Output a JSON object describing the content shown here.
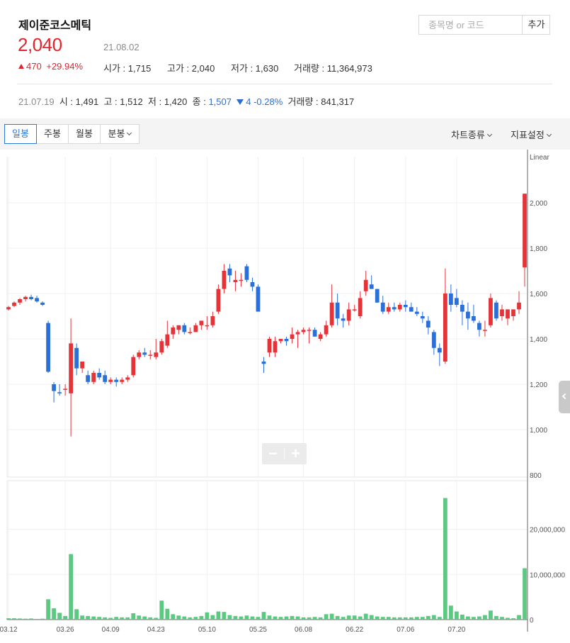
{
  "stock": {
    "name": "제이준코스메틱",
    "price": "2,040",
    "date": "21.08.02",
    "change": "470",
    "change_pct": "+29.94%",
    "open_label": "시가",
    "open": "1,715",
    "high_label": "고가",
    "high": "2,040",
    "low_label": "저가",
    "low": "1,630",
    "volume_label": "거래량",
    "volume": "11,364,973"
  },
  "search": {
    "placeholder": "종목명 or 코드",
    "add_label": "추가"
  },
  "previous": {
    "date": "21.07.19",
    "open_label": "시",
    "open": "1,491",
    "high_label": "고",
    "high": "1,512",
    "low_label": "저",
    "low": "1,420",
    "close_label": "종",
    "close": "1,507",
    "change": "4",
    "change_pct": "-0.28%",
    "volume_label": "거래량",
    "volume": "841,317"
  },
  "toolbar": {
    "tabs": [
      "일봉",
      "주봉",
      "월봉",
      "분봉"
    ],
    "chart_type_label": "차트종류",
    "indicator_label": "지표설정"
  },
  "colors": {
    "up": "#e3343a",
    "down": "#2c6fd6",
    "volume": "#5dc882"
  },
  "chart_data": {
    "type": "candlestick",
    "scale_label": "Linear",
    "price_ticks": [
      2000,
      1800,
      1600,
      1400,
      1200,
      1000,
      800
    ],
    "price_tick_labels": [
      "2,000",
      "1,800",
      "1,600",
      "1,400",
      "1,200",
      "1,000",
      "800"
    ],
    "volume_ticks": [
      20000000,
      10000000,
      0
    ],
    "volume_tick_labels": [
      "20,000,000",
      "10,000,000",
      "0"
    ],
    "x_tick_labels": [
      "03.12",
      "03.26",
      "04.09",
      "04.23",
      "05.10",
      "05.25",
      "06.08",
      "06.22",
      "07.06",
      "07.20"
    ],
    "x_tick_index": [
      0,
      10,
      18,
      26,
      35,
      44,
      52,
      61,
      70,
      79
    ],
    "candles": [
      [
        1530,
        1545,
        1525,
        1540
      ],
      [
        1545,
        1565,
        1540,
        1560
      ],
      [
        1560,
        1580,
        1550,
        1575
      ],
      [
        1575,
        1590,
        1565,
        1585
      ],
      [
        1585,
        1595,
        1570,
        1575
      ],
      [
        1580,
        1590,
        1560,
        1565
      ],
      [
        1560,
        1565,
        1545,
        1550
      ],
      [
        1470,
        1480,
        1250,
        1255
      ],
      [
        1200,
        1210,
        1120,
        1170
      ],
      [
        1165,
        1200,
        1150,
        1160
      ],
      [
        1180,
        1200,
        1150,
        1180
      ],
      [
        1160,
        1490,
        970,
        1380
      ],
      [
        1360,
        1380,
        1240,
        1270
      ],
      [
        1270,
        1300,
        1250,
        1300
      ],
      [
        1240,
        1260,
        1200,
        1210
      ],
      [
        1210,
        1260,
        1200,
        1250
      ],
      [
        1250,
        1270,
        1220,
        1230
      ],
      [
        1240,
        1260,
        1200,
        1210
      ],
      [
        1210,
        1230,
        1200,
        1220
      ],
      [
        1220,
        1230,
        1190,
        1210
      ],
      [
        1210,
        1230,
        1200,
        1220
      ],
      [
        1220,
        1240,
        1210,
        1230
      ],
      [
        1240,
        1330,
        1230,
        1320
      ],
      [
        1320,
        1350,
        1310,
        1340
      ],
      [
        1340,
        1360,
        1320,
        1330
      ],
      [
        1330,
        1350,
        1310,
        1330
      ],
      [
        1320,
        1400,
        1310,
        1340
      ],
      [
        1340,
        1400,
        1330,
        1390
      ],
      [
        1370,
        1480,
        1360,
        1420
      ],
      [
        1420,
        1460,
        1400,
        1450
      ],
      [
        1440,
        1460,
        1420,
        1460
      ],
      [
        1460,
        1470,
        1420,
        1430
      ],
      [
        1430,
        1450,
        1420,
        1430
      ],
      [
        1430,
        1470,
        1430,
        1460
      ],
      [
        1460,
        1480,
        1440,
        1480
      ],
      [
        1460,
        1500,
        1440,
        1460
      ],
      [
        1460,
        1520,
        1450,
        1500
      ],
      [
        1520,
        1640,
        1510,
        1620
      ],
      [
        1620,
        1730,
        1600,
        1700
      ],
      [
        1710,
        1730,
        1650,
        1680
      ],
      [
        1650,
        1700,
        1610,
        1660
      ],
      [
        1660,
        1690,
        1630,
        1660
      ],
      [
        1720,
        1730,
        1650,
        1660
      ],
      [
        1650,
        1670,
        1610,
        1630
      ],
      [
        1630,
        1640,
        1560,
        1520
      ],
      [
        1300,
        1320,
        1250,
        1290
      ],
      [
        1340,
        1410,
        1320,
        1400
      ],
      [
        1340,
        1410,
        1320,
        1390
      ],
      [
        1390,
        1400,
        1380,
        1400
      ],
      [
        1400,
        1410,
        1370,
        1390
      ],
      [
        1400,
        1450,
        1380,
        1420
      ],
      [
        1420,
        1440,
        1360,
        1430
      ],
      [
        1430,
        1450,
        1420,
        1440
      ],
      [
        1440,
        1450,
        1380,
        1440
      ],
      [
        1440,
        1450,
        1430,
        1410
      ],
      [
        1400,
        1430,
        1390,
        1420
      ],
      [
        1420,
        1480,
        1410,
        1460
      ],
      [
        1460,
        1640,
        1450,
        1560
      ],
      [
        1560,
        1600,
        1460,
        1490
      ],
      [
        1490,
        1510,
        1450,
        1480
      ],
      [
        1480,
        1560,
        1460,
        1530
      ],
      [
        1530,
        1550,
        1520,
        1530
      ],
      [
        1500,
        1610,
        1490,
        1580
      ],
      [
        1610,
        1700,
        1590,
        1660
      ],
      [
        1640,
        1680,
        1620,
        1620
      ],
      [
        1620,
        1620,
        1560,
        1560
      ],
      [
        1560,
        1590,
        1510,
        1520
      ],
      [
        1520,
        1560,
        1510,
        1540
      ],
      [
        1540,
        1560,
        1520,
        1530
      ],
      [
        1530,
        1560,
        1520,
        1550
      ],
      [
        1550,
        1570,
        1520,
        1540
      ],
      [
        1540,
        1560,
        1520,
        1520
      ],
      [
        1520,
        1540,
        1500,
        1510
      ],
      [
        1500,
        1520,
        1470,
        1490
      ],
      [
        1480,
        1500,
        1420,
        1450
      ],
      [
        1430,
        1440,
        1330,
        1360
      ],
      [
        1360,
        1380,
        1280,
        1340
      ],
      [
        1300,
        1710,
        1290,
        1600
      ],
      [
        1600,
        1640,
        1520,
        1550
      ],
      [
        1580,
        1620,
        1540,
        1550
      ],
      [
        1550,
        1570,
        1460,
        1520
      ],
      [
        1520,
        1560,
        1440,
        1490
      ],
      [
        1500,
        1550,
        1470,
        1480
      ],
      [
        1470,
        1480,
        1410,
        1440
      ],
      [
        1440,
        1480,
        1410,
        1440
      ],
      [
        1460,
        1600,
        1450,
        1580
      ],
      [
        1560,
        1570,
        1480,
        1490
      ],
      [
        1500,
        1550,
        1480,
        1530
      ],
      [
        1490,
        1520,
        1460,
        1530
      ],
      [
        1500,
        1530,
        1480,
        1530
      ],
      [
        1530,
        1610,
        1510,
        1560
      ],
      [
        1715,
        2040,
        1630,
        2040
      ]
    ],
    "volumes": [
      300000,
      300000,
      250000,
      200000,
      250000,
      150000,
      200000,
      4500000,
      2500000,
      1500000,
      800000,
      14500000,
      2300000,
      900000,
      800000,
      700000,
      600000,
      500000,
      400000,
      600000,
      500000,
      500000,
      1400000,
      900000,
      700000,
      500000,
      400000,
      4200000,
      2400000,
      1200000,
      900000,
      700000,
      500000,
      600000,
      800000,
      1600000,
      1000000,
      1800000,
      1700000,
      1000000,
      800000,
      700000,
      900000,
      700000,
      600000,
      1700000,
      900000,
      700000,
      600000,
      700000,
      800000,
      700000,
      500000,
      500000,
      600000,
      500000,
      1200000,
      1300000,
      800000,
      600000,
      900000,
      900000,
      700000,
      1300000,
      1000000,
      700000,
      600000,
      600000,
      500000,
      500000,
      500000,
      500000,
      600000,
      600000,
      800000,
      1000000,
      600000,
      26900000,
      3100000,
      1800000,
      1100000,
      700000,
      600000,
      700000,
      1000000,
      2000000,
      800000,
      600000,
      400000,
      300000,
      1000000,
      11364973
    ]
  }
}
